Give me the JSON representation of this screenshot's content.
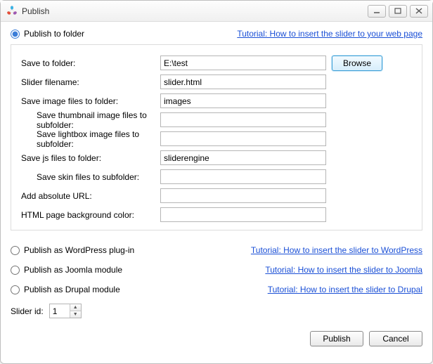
{
  "window": {
    "title": "Publish"
  },
  "top": {
    "radio_label": "Publish to folder",
    "tutorial_link": "Tutorial: How to insert the slider to your web page"
  },
  "form": {
    "save_folder_label": "Save to folder:",
    "save_folder_value": "E:\\test",
    "browse_label": "Browse",
    "slider_filename_label": "Slider filename:",
    "slider_filename_value": "slider.html",
    "images_folder_label": "Save image files to folder:",
    "images_folder_value": "images",
    "thumb_subfolder_label": "Save thumbnail image files to subfolder:",
    "thumb_subfolder_value": "",
    "lightbox_subfolder_label": "Save lightbox image files to subfolder:",
    "lightbox_subfolder_value": "",
    "js_folder_label": "Save js files to folder:",
    "js_folder_value": "sliderengine",
    "skin_subfolder_label": "Save skin files to subfolder:",
    "skin_subfolder_value": "",
    "abs_url_label": "Add absolute URL:",
    "abs_url_value": "",
    "bg_color_label": "HTML page background color:",
    "bg_color_value": ""
  },
  "alts": {
    "wordpress_label": "Publish as WordPress plug-in",
    "wordpress_link": "Tutorial: How to insert the slider to WordPress",
    "joomla_label": "Publish as Joomla module",
    "joomla_link": "Tutorial: How to insert the slider to Joomla",
    "drupal_label": "Publish as Drupal module",
    "drupal_link": "Tutorial: How to insert the slider to Drupal"
  },
  "slider_id": {
    "label": "Slider id:",
    "value": "1"
  },
  "footer": {
    "publish": "Publish",
    "cancel": "Cancel"
  }
}
